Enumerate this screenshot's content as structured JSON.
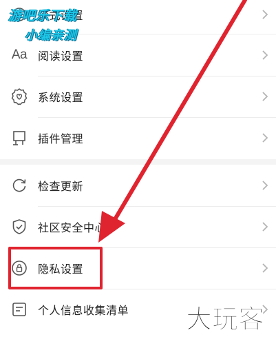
{
  "settings_list": {
    "items": [
      {
        "label": "模式设置",
        "icon": "settings-icon"
      },
      {
        "label": "阅读设置",
        "icon": "aa-text-icon",
        "icon_text": "Aa"
      },
      {
        "label": "系统设置",
        "icon": "heart-badge-icon"
      },
      {
        "label": "插件管理",
        "icon": "plugin-icon"
      },
      {
        "label": "检查更新",
        "icon": "refresh-icon"
      },
      {
        "label": "社区安全中心",
        "icon": "shield-check-icon"
      },
      {
        "label": "隐私设置",
        "icon": "lock-icon"
      },
      {
        "label": "个人信息收集清单",
        "icon": "id-card-icon"
      }
    ]
  },
  "watermark": {
    "top_line1": "游吧乐下载",
    "top_line2": "小编亲测",
    "bottom": "大玩客"
  },
  "colors": {
    "highlight": "#e0242f",
    "watermark_top": "#1ec8e8",
    "text": "#222222",
    "icon": "#555555"
  }
}
